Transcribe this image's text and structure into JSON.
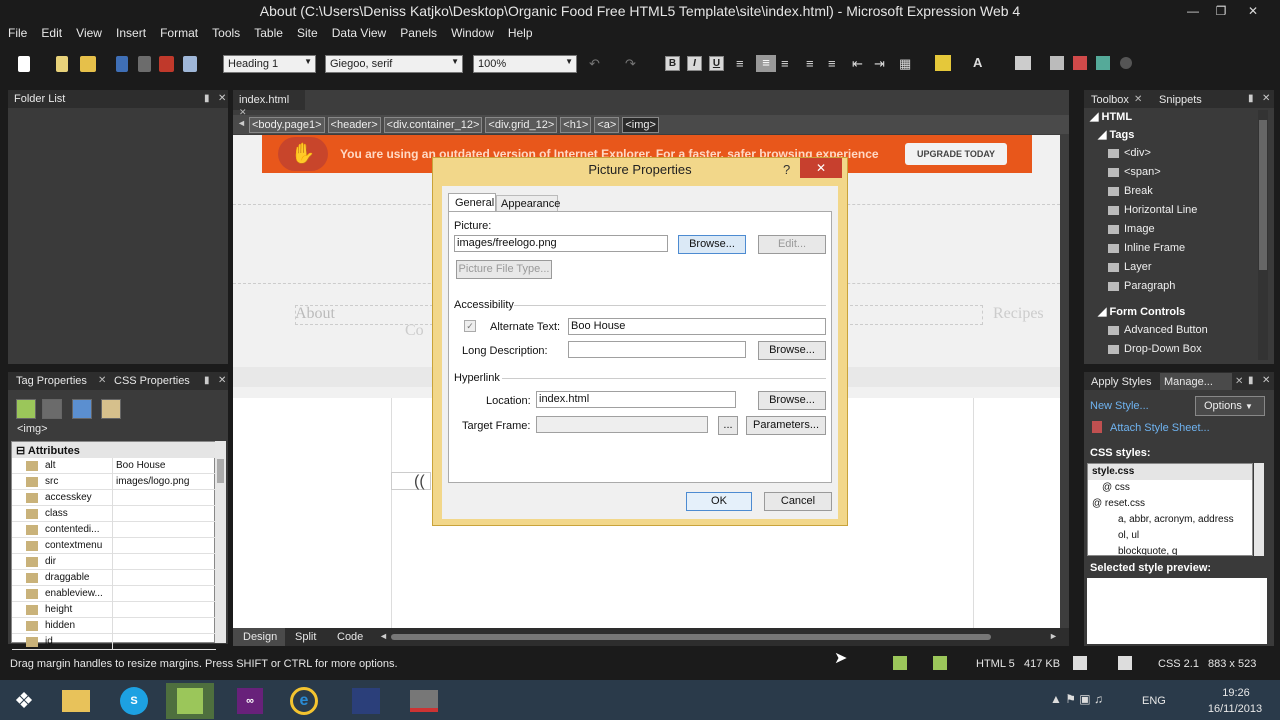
{
  "window": {
    "title": "About (C:\\Users\\Deniss Katjko\\Desktop\\Organic Food Free HTML5 Template\\site\\index.html) - Microsoft Expression Web 4"
  },
  "menu": [
    "File",
    "Edit",
    "View",
    "Insert",
    "Format",
    "Tools",
    "Table",
    "Site",
    "Data View",
    "Panels",
    "Window",
    "Help"
  ],
  "toolbar": {
    "style_select": "Heading 1",
    "font_select": "Giegoo, serif",
    "zoom_select": "100%",
    "bold": "B",
    "italic": "I",
    "underline": "U"
  },
  "folder_list": {
    "title": "Folder List"
  },
  "document": {
    "tab": "index.html",
    "breadcrumbs": [
      "<body.page1>",
      "<header>",
      "<div.container_12>",
      "<div.grid_12>",
      "<h1>",
      "<a>",
      "<img>"
    ],
    "ie_banner_text": "You are using an outdated version of Internet Explorer. For a faster, safer browsing experience",
    "ie_banner_button": "UPGRADE TODAY",
    "nav_about": "About",
    "nav_recipes": "Recipes",
    "nav_contact_partial": "Co",
    "view_tabs": [
      "Design",
      "Split",
      "Code"
    ]
  },
  "tag_properties": {
    "tab1": "Tag Properties",
    "tab2": "CSS Properties",
    "tag": "<img>",
    "section": "Attributes",
    "attributes": [
      {
        "name": "alt",
        "value": "Boo House"
      },
      {
        "name": "src",
        "value": "images/logo.png"
      },
      {
        "name": "accesskey",
        "value": ""
      },
      {
        "name": "class",
        "value": ""
      },
      {
        "name": "contentedi...",
        "value": ""
      },
      {
        "name": "contextmenu",
        "value": ""
      },
      {
        "name": "dir",
        "value": ""
      },
      {
        "name": "draggable",
        "value": ""
      },
      {
        "name": "enableview...",
        "value": ""
      },
      {
        "name": "height",
        "value": ""
      },
      {
        "name": "hidden",
        "value": ""
      },
      {
        "name": "id",
        "value": ""
      }
    ]
  },
  "toolbox": {
    "tab1": "Toolbox",
    "tab2": "Snippets",
    "html": "HTML",
    "tags": "Tags",
    "tag_items": [
      "<div>",
      "<span>",
      "Break",
      "Horizontal Line",
      "Image",
      "Inline Frame",
      "Layer",
      "Paragraph"
    ],
    "form_controls": "Form Controls",
    "form_items": [
      "Advanced Button",
      "Drop-Down Box"
    ]
  },
  "apply_styles": {
    "tab1": "Apply Styles",
    "tab2": "Manage...",
    "new_style": "New Style...",
    "options": "Options",
    "attach": "Attach Style Sheet...",
    "css_styles_label": "CSS styles:",
    "tree": [
      {
        "label": "style.css",
        "level": 0
      },
      {
        "label": "@ css",
        "level": 1
      },
      {
        "label": "@ reset.css",
        "level": 0
      },
      {
        "label": "a, abbr, acronym, address",
        "level": 2
      },
      {
        "label": "ol, ul",
        "level": 2
      },
      {
        "label": "blockquote, q",
        "level": 2
      }
    ],
    "preview_label": "Selected style preview:"
  },
  "dialog": {
    "title": "Picture Properties",
    "help": "?",
    "tabs": [
      "General",
      "Appearance"
    ],
    "picture_label": "Picture:",
    "picture_value": "images/freelogo.png",
    "browse": "Browse...",
    "edit": "Edit...",
    "picture_file_type": "Picture File Type...",
    "accessibility": "Accessibility",
    "alt_label": "Alternate Text:",
    "alt_value": "Boo House",
    "long_desc_label": "Long Description:",
    "long_desc_value": "",
    "browse2": "Browse...",
    "hyperlink": "Hyperlink",
    "location_label": "Location:",
    "location_value": "index.html",
    "browse3": "Browse...",
    "target_frame_label": "Target Frame:",
    "target_frame_value": "",
    "target_btn": "...",
    "parameters": "Parameters...",
    "ok": "OK",
    "cancel": "Cancel"
  },
  "statusbar": {
    "message": "Drag margin handles to resize margins. Press SHIFT or CTRL for more options.",
    "html_version": "HTML 5",
    "size": "417 KB",
    "css_version": "CSS 2.1",
    "dimensions": "883 x 523"
  },
  "taskbar": {
    "lang": "ENG",
    "time": "19:26",
    "date": "16/11/2013"
  }
}
